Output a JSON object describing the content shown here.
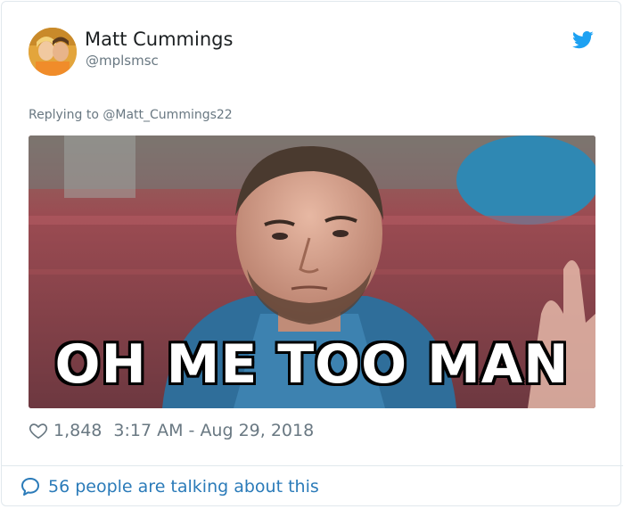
{
  "tweet": {
    "author": {
      "display_name": "Matt Cummings",
      "handle": "@mplsmsc",
      "avatar_icon": "avatar-photo"
    },
    "brand_icon": "twitter-bird-icon",
    "brand_color": "#1da1f2",
    "reply_prefix": "Replying to ",
    "reply_to": "@Matt_Cummings22",
    "media": {
      "caption": "OH ME TOO MAN"
    },
    "likes": "1,848",
    "timestamp": "3:17 AM - Aug 29, 2018"
  },
  "footer": {
    "talking_label": "56 people are talking about this",
    "icon": "speech-bubble-icon",
    "link_color": "#2b7bb9"
  }
}
